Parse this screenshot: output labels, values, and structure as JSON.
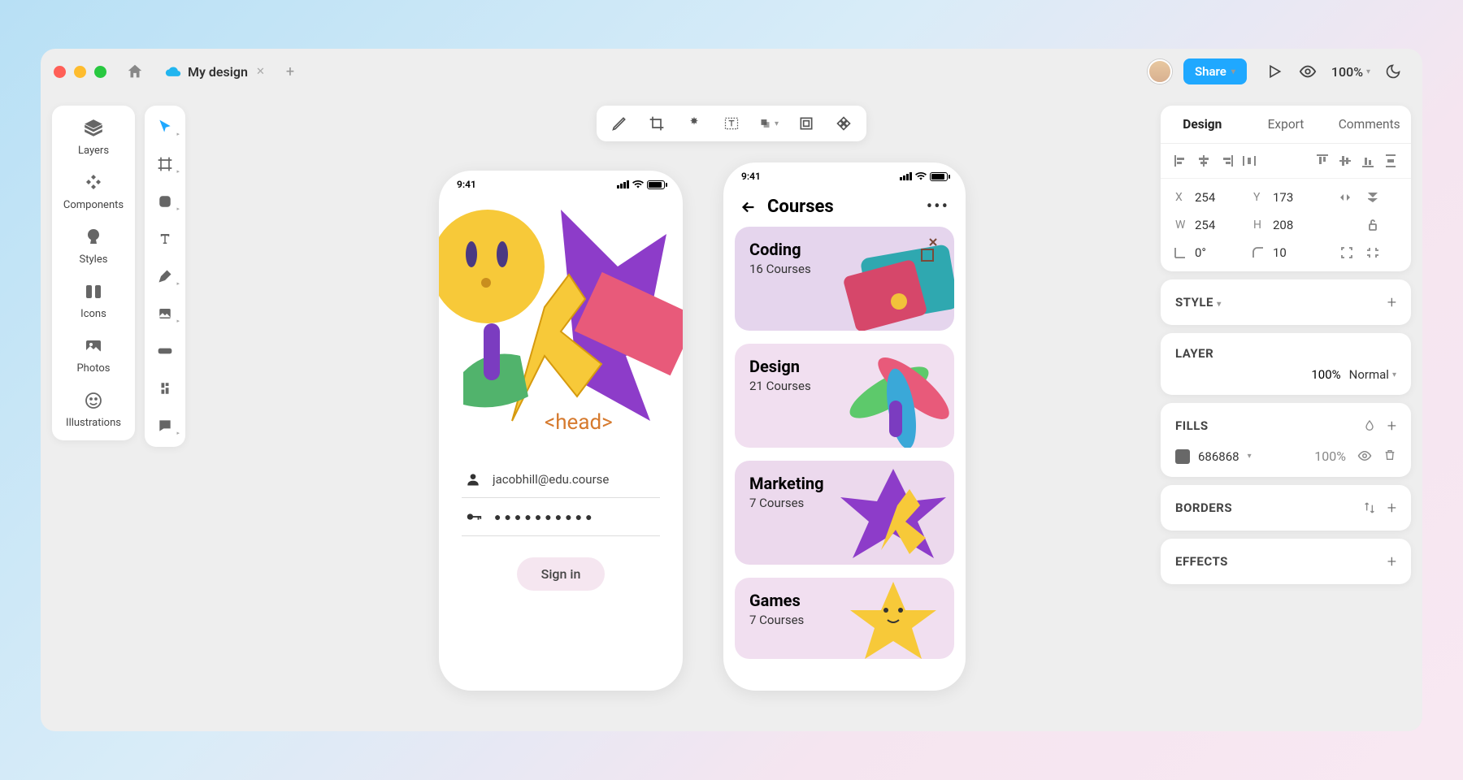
{
  "tab": {
    "title": "My design"
  },
  "topbar": {
    "share": "Share",
    "zoom": "100%"
  },
  "leftnav": {
    "items": [
      "Layers",
      "Components",
      "Styles",
      "Icons",
      "Photos",
      "Illustrations"
    ]
  },
  "artboard1": {
    "time": "9:41",
    "head_tag": "<head>",
    "email": "jacobhill@edu.course",
    "signin": "Sign in"
  },
  "artboard2": {
    "time": "9:41",
    "title": "Courses",
    "cards": [
      {
        "title": "Coding",
        "sub": "16 Courses"
      },
      {
        "title": "Design",
        "sub": "21 Courses"
      },
      {
        "title": "Marketing",
        "sub": "7 Courses"
      },
      {
        "title": "Games",
        "sub": "7 Courses"
      }
    ]
  },
  "props": {
    "tabs": [
      "Design",
      "Export",
      "Comments"
    ],
    "x": "254",
    "y": "173",
    "w": "254",
    "h": "208",
    "angle": "0°",
    "radius": "10",
    "style_title": "STYLE",
    "layer_title": "LAYER",
    "layer_opacity": "100%",
    "blend": "Normal",
    "fills_title": "FILLS",
    "fill_hex": "686868",
    "fill_opacity": "100%",
    "borders_title": "BORDERS",
    "effects_title": "EFFECTS"
  }
}
